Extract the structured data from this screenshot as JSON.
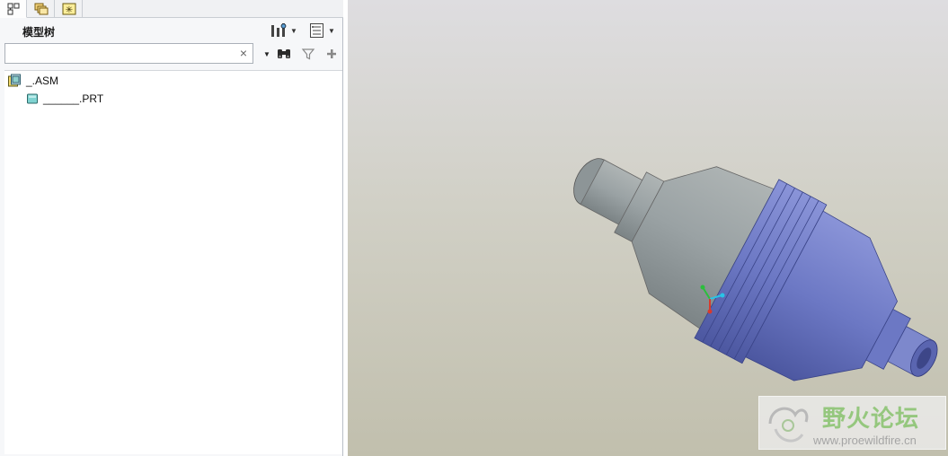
{
  "panel_tabs": [
    {
      "icon": "model-tree-tab-icon",
      "active": true
    },
    {
      "icon": "layers-tab-icon",
      "active": false
    },
    {
      "icon": "favorites-tab-icon",
      "active": false
    }
  ],
  "model_tree": {
    "title": "模型树",
    "settings_icon": "tree-settings-icon",
    "columns_icon": "tree-columns-icon",
    "search": {
      "value": "",
      "placeholder": "",
      "clear_icon": "×"
    },
    "tools": [
      "binoculars-icon",
      "filter-icon",
      "add-icon"
    ],
    "nodes": [
      {
        "label": "_.ASM",
        "icon": "assembly-icon",
        "level": 0
      },
      {
        "label": "______.PRT",
        "icon": "part-icon",
        "level": 1
      }
    ]
  },
  "viewport": {
    "colors": {
      "housing_gray": "#9aa2a4",
      "body_blue": "#6c78c4",
      "bg_top": "#dedde0",
      "bg_bottom": "#c1bfad"
    },
    "axes": [
      "x-axis-green",
      "y-axis-cyan",
      "z-axis-red"
    ]
  },
  "watermark": {
    "title": "野火论坛",
    "url": "www.proewildfire.cn"
  }
}
